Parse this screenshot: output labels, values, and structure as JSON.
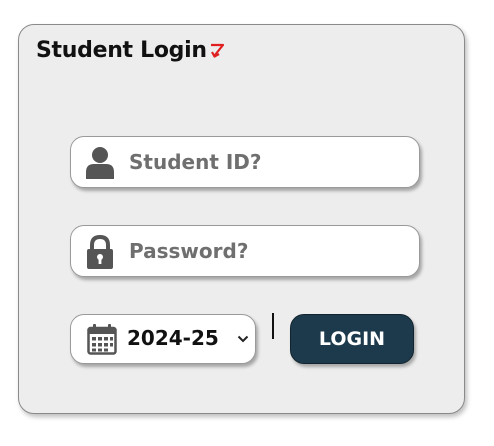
{
  "login": {
    "title": "Student Login",
    "student_id": {
      "placeholder": "Student ID?",
      "value": ""
    },
    "password": {
      "placeholder": "Password?",
      "value": ""
    },
    "session": {
      "selected": "2024-25"
    },
    "login_button": "LOGIN"
  },
  "icons": {
    "title_arrow": "down-arrow-icon",
    "student_id": "user-icon",
    "password": "lock-icon",
    "session": "calendar-icon",
    "dropdown": "chevron-down-icon"
  },
  "colors": {
    "panel_bg": "#ededed",
    "button_bg": "#1d3a4c",
    "arrow_red": "#e02020",
    "icon_gray": "#555555"
  }
}
